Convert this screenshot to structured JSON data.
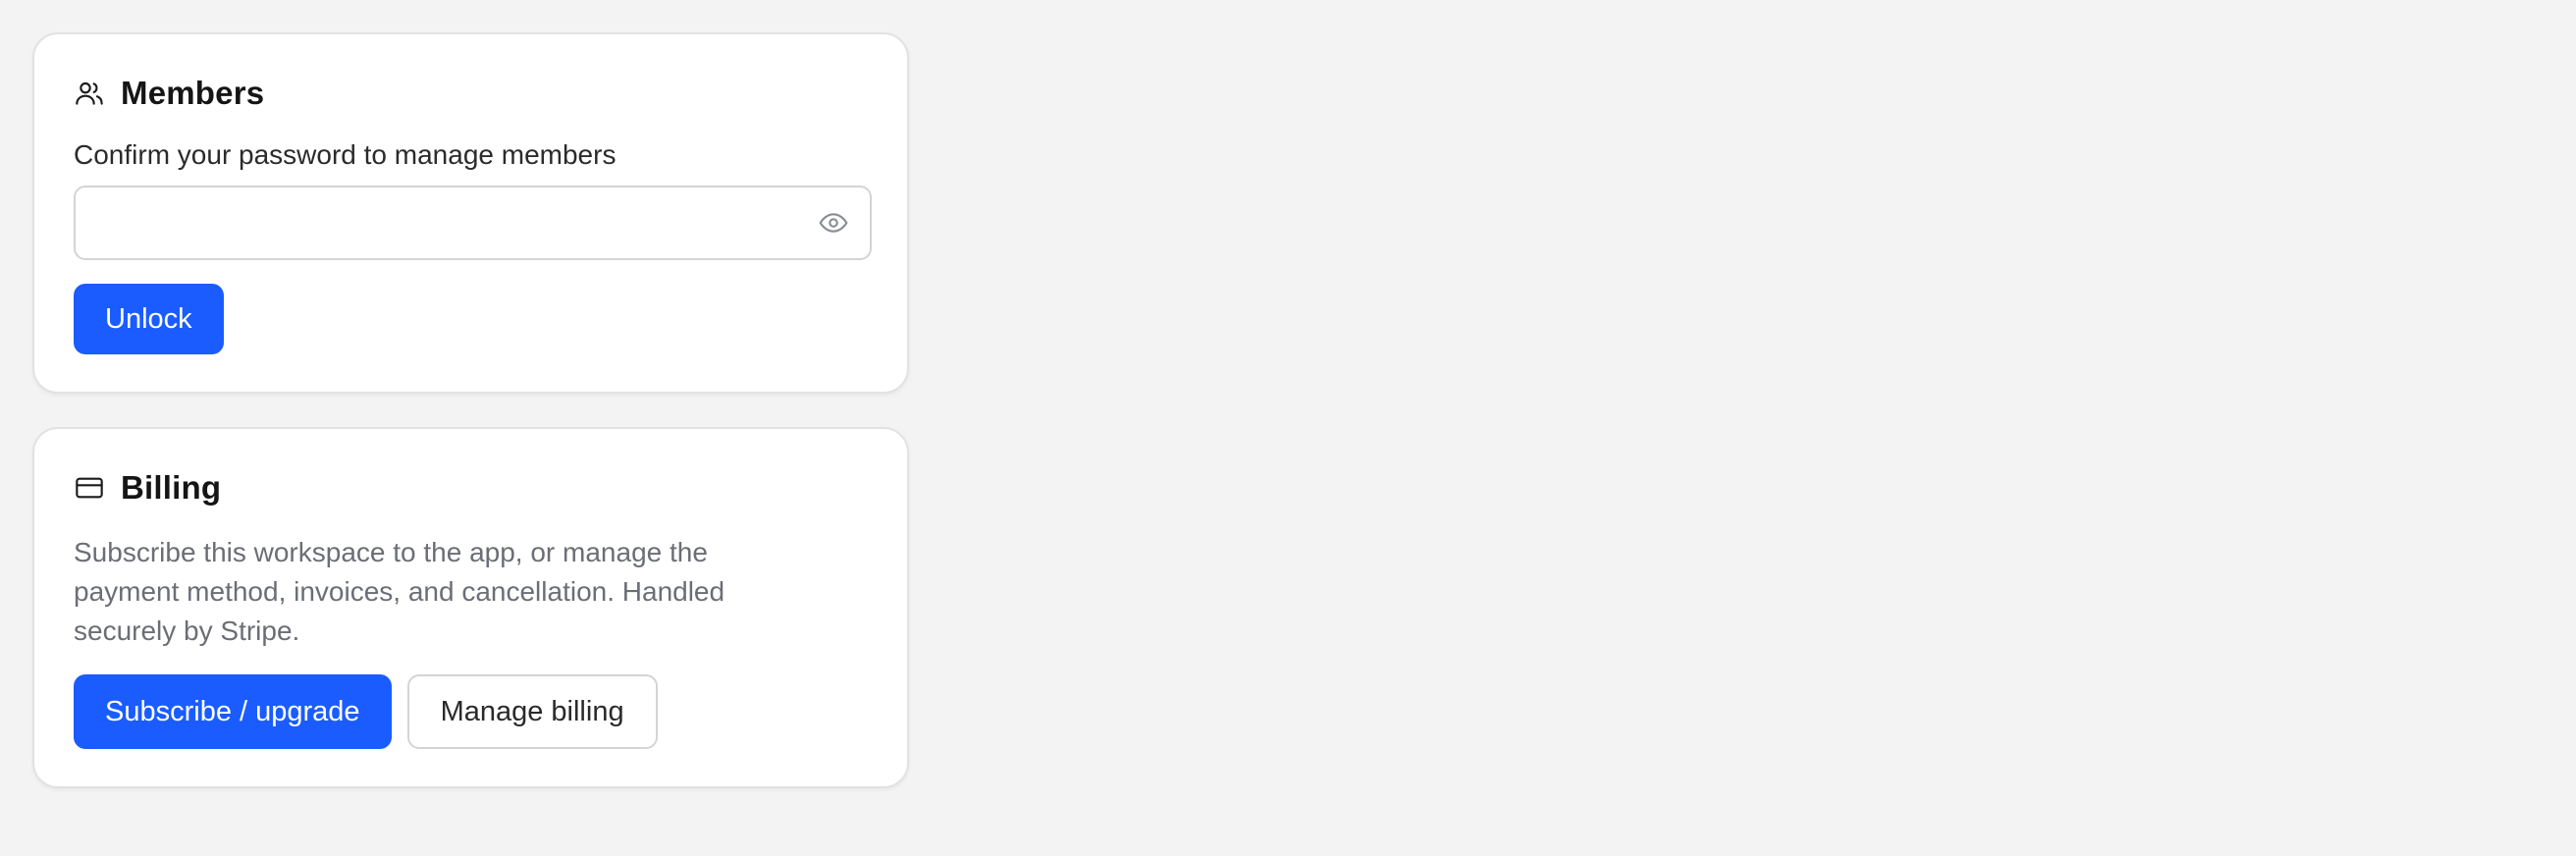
{
  "members": {
    "title": "Members",
    "icon": "users-icon",
    "password_label": "Confirm your password to manage members",
    "password_value": "",
    "password_placeholder": "",
    "toggle_visibility_icon": "eye-icon",
    "unlock_label": "Unlock"
  },
  "billing": {
    "title": "Billing",
    "icon": "credit-card-icon",
    "description": "Subscribe this workspace to the app, or manage the payment method, invoices, and cancellation. Handled securely by Stripe.",
    "subscribe_label": "Subscribe / upgrade",
    "manage_label": "Manage billing"
  },
  "colors": {
    "accent": "#1a5cff",
    "background": "#f3f3f3",
    "card": "#ffffff",
    "muted_text": "#6b6e75"
  }
}
